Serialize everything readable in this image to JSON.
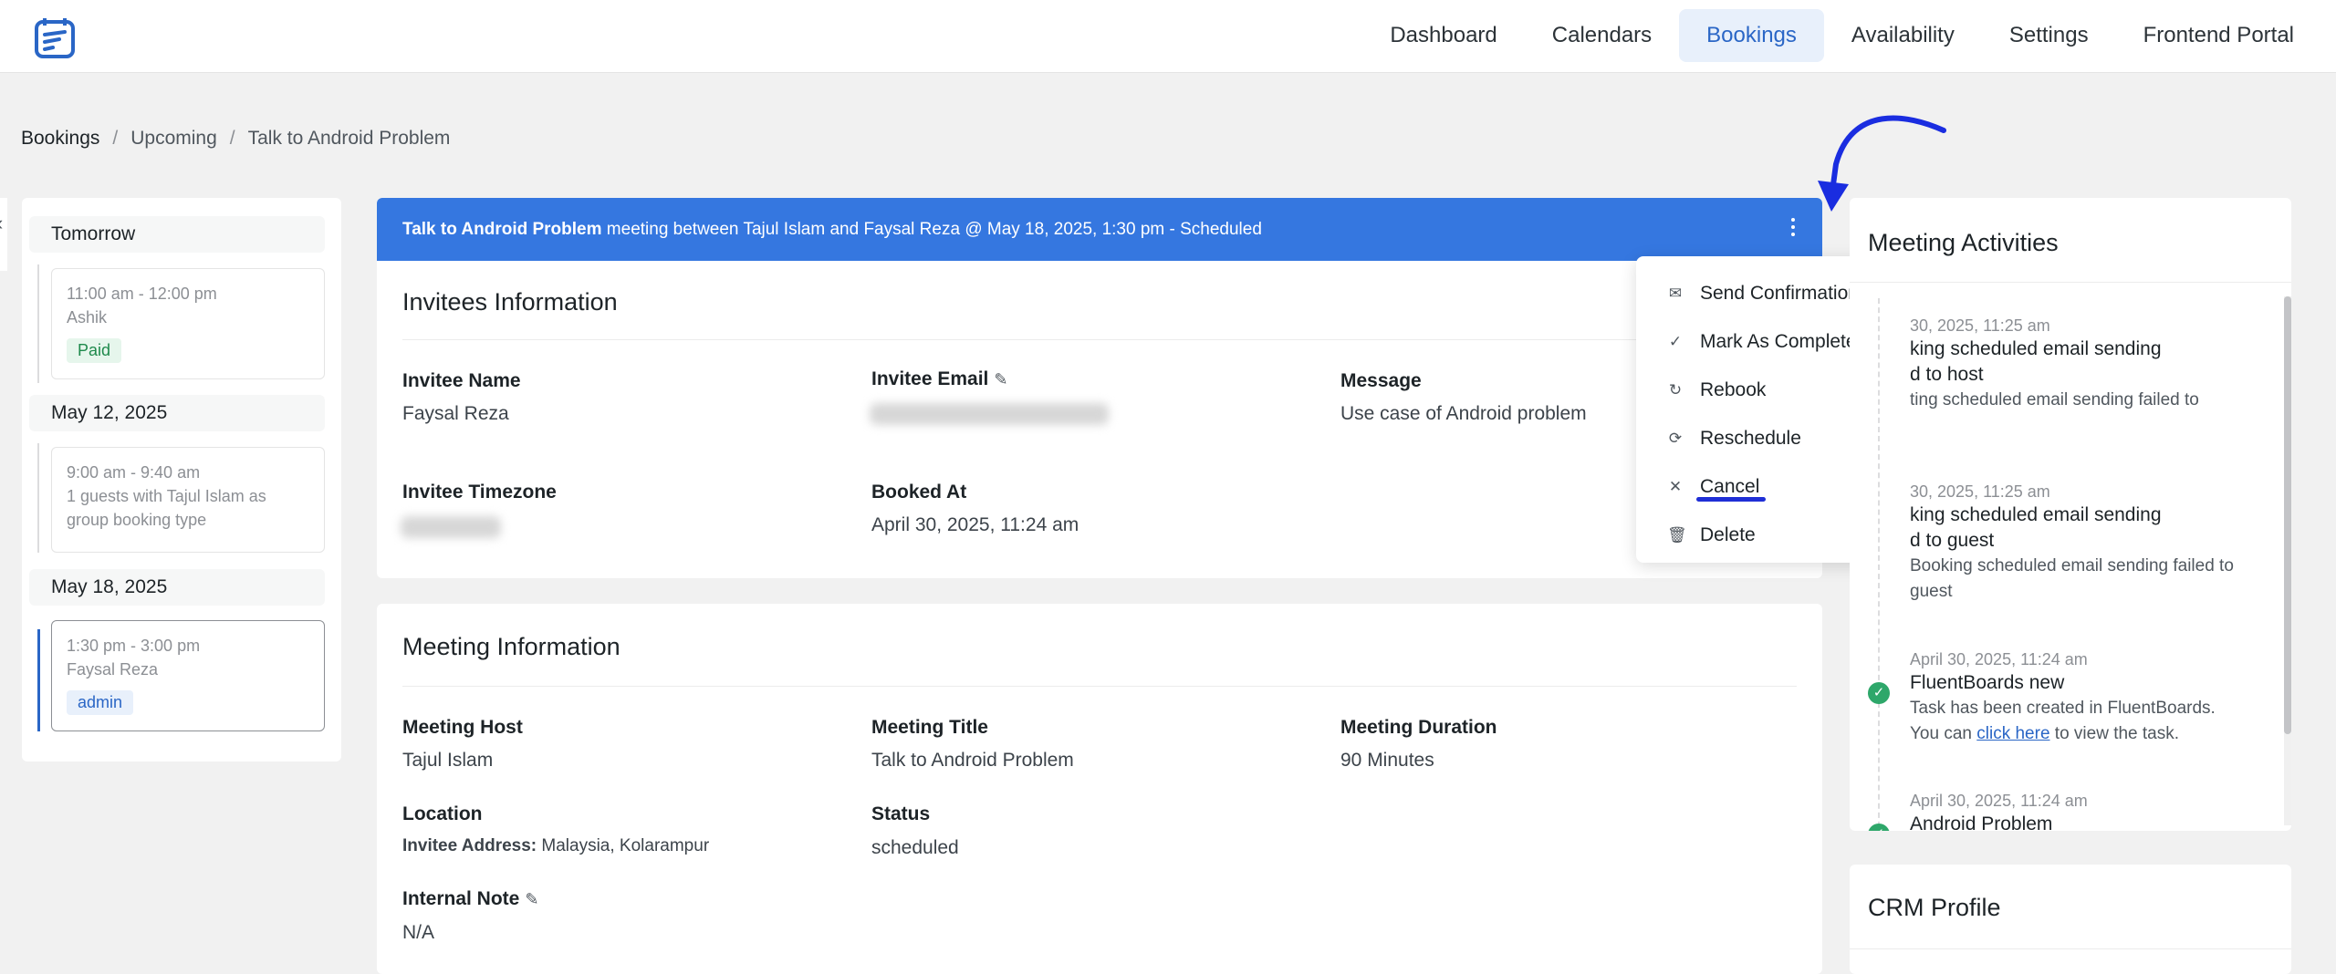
{
  "nav": {
    "items": [
      "Dashboard",
      "Calendars",
      "Bookings",
      "Availability",
      "Settings",
      "Frontend Portal"
    ],
    "active": "Bookings"
  },
  "breadcrumb": [
    "Bookings",
    "Upcoming",
    "Talk to Android Problem"
  ],
  "sidebar": {
    "groups": [
      {
        "date": "Tomorrow",
        "time": "11:00 am - 12:00 pm",
        "who": "Ashik",
        "badge": "Paid"
      },
      {
        "date": "May 12, 2025",
        "time": "9:00 am - 9:40 am",
        "who": "1 guests with Tajul Islam as group booking type"
      },
      {
        "date": "May 18, 2025",
        "time": "1:30 pm - 3:00 pm",
        "who": "Faysal Reza",
        "badge": "admin"
      }
    ]
  },
  "banner": {
    "title": "Talk to Android Problem",
    "rest": " meeting between Tajul Islam and Faysal Reza @ May 18, 2025, 1:30 pm - Scheduled"
  },
  "invitees": {
    "title": "Invitees Information",
    "name_label": "Invitee Name",
    "name_value": "Faysal Reza",
    "email_label": "Invitee Email",
    "message_label": "Message",
    "message_value": "Use case of Android problem",
    "tz_label": "Invitee Timezone",
    "booked_label": "Booked At",
    "booked_value": "April 30, 2025, 11:24 am"
  },
  "meeting": {
    "title": "Meeting Information",
    "host_label": "Meeting Host",
    "host_value": "Tajul Islam",
    "mtitle_label": "Meeting Title",
    "mtitle_value": "Talk to Android Problem",
    "duration_label": "Meeting Duration",
    "duration_value": "90 Minutes",
    "location_label": "Location",
    "location_prefix": "Invitee Address:",
    "location_value": " Malaysia, Kolarampur",
    "status_label": "Status",
    "status_value": "scheduled",
    "note_label": "Internal Note",
    "note_value": "N/A"
  },
  "menu": {
    "items": [
      {
        "label": "Send Confirmation Email",
        "icon": "mail-icon"
      },
      {
        "label": "Mark As Completed",
        "icon": "check-icon"
      },
      {
        "label": "Rebook",
        "icon": "refresh-icon"
      },
      {
        "label": "Reschedule",
        "icon": "reschedule-icon"
      },
      {
        "label": "Cancel",
        "icon": "close-icon"
      },
      {
        "label": "Delete",
        "icon": "trash-icon"
      }
    ]
  },
  "activities": {
    "title": "Meeting Activities",
    "items": [
      {
        "ts": "30, 2025, 11:25 am",
        "head1": "king scheduled email sending",
        "head2": "d to host",
        "desc": "ting scheduled email sending failed to"
      },
      {
        "ts": "30, 2025, 11:25 am",
        "head1": "king scheduled email sending",
        "head2": "d to guest",
        "desc": "Booking scheduled email sending failed to guest"
      },
      {
        "ts": "April 30, 2025, 11:24 am",
        "head": "FluentBoards new",
        "desc1": "Task has been created in FluentBoards.",
        "desc2_pre": "You can ",
        "link": "click here",
        "desc2_post": " to view the task."
      },
      {
        "ts": "April 30, 2025, 11:24 am",
        "head": "Android Problem"
      }
    ]
  },
  "crm": {
    "title": "CRM Profile"
  }
}
